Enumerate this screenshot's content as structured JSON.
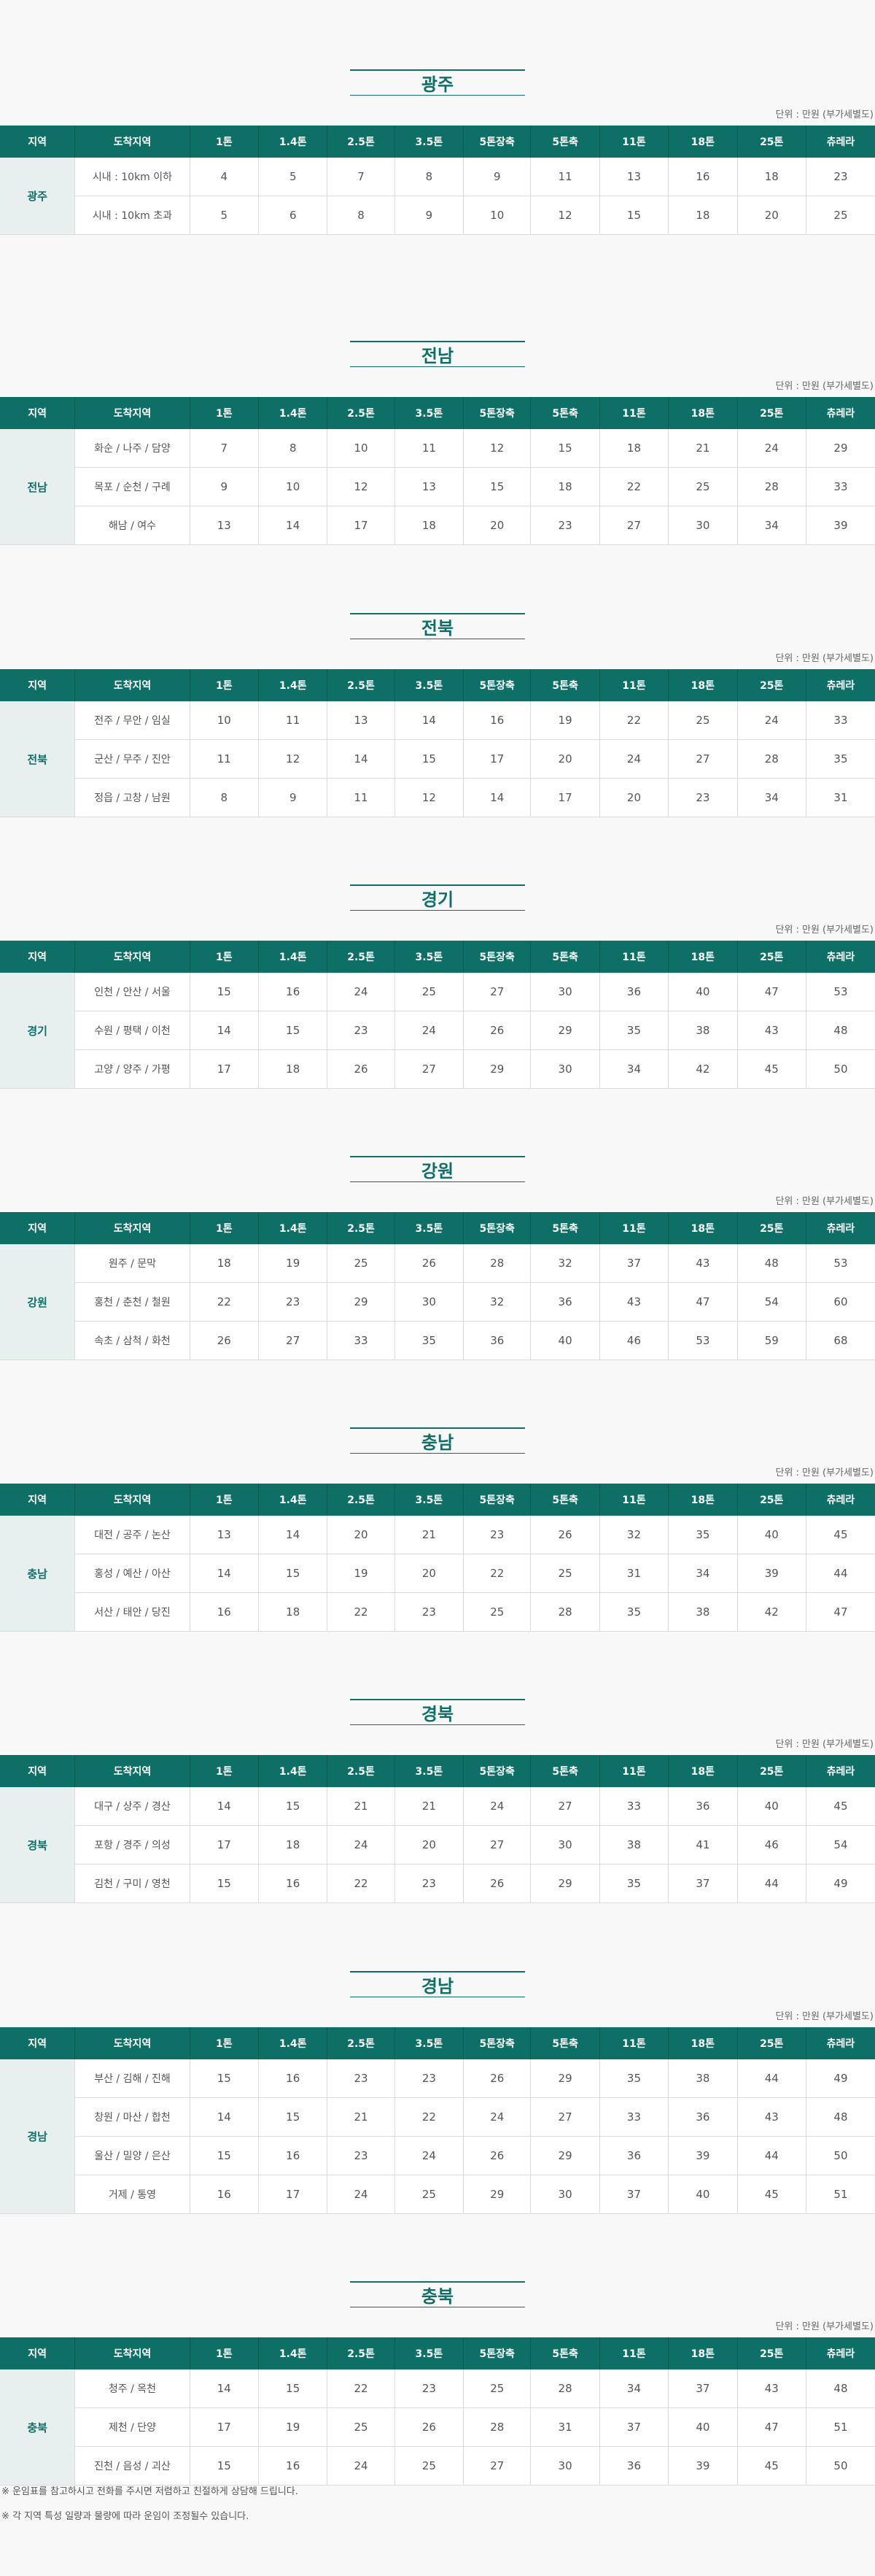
{
  "unit_label": "단위 : 만원 (부가세별도)",
  "headers": [
    "지역",
    "도착지역",
    "1톤",
    "1.4톤",
    "2.5톤",
    "3.5톤",
    "5톤장축",
    "5톤축",
    "11톤",
    "18톤",
    "25톤",
    "츄레라"
  ],
  "sections": [
    {
      "title": "광주",
      "region": "광주",
      "rows": [
        {
          "dest": "시내 : 10km 이하",
          "values": [
            "4",
            "5",
            "7",
            "8",
            "9",
            "11",
            "13",
            "16",
            "18",
            "23"
          ]
        },
        {
          "dest": "시내 : 10km 초과",
          "values": [
            "5",
            "6",
            "8",
            "9",
            "10",
            "12",
            "15",
            "18",
            "20",
            "25"
          ]
        }
      ]
    },
    {
      "title": "전남",
      "region": "전남",
      "rows": [
        {
          "dest": "화순 / 나주 / 담양",
          "values": [
            "7",
            "8",
            "10",
            "11",
            "12",
            "15",
            "18",
            "21",
            "24",
            "29"
          ]
        },
        {
          "dest": "목포 / 순천 / 구례",
          "values": [
            "9",
            "10",
            "12",
            "13",
            "15",
            "18",
            "22",
            "25",
            "28",
            "33"
          ]
        },
        {
          "dest": "해남 / 여수",
          "values": [
            "13",
            "14",
            "17",
            "18",
            "20",
            "23",
            "27",
            "30",
            "34",
            "39"
          ]
        }
      ]
    },
    {
      "title": "전북",
      "region": "전북",
      "rows": [
        {
          "dest": "전주 / 무안 / 임실",
          "values": [
            "10",
            "11",
            "13",
            "14",
            "16",
            "19",
            "22",
            "25",
            "24",
            "33"
          ]
        },
        {
          "dest": "군산 / 무주 / 진안",
          "values": [
            "11",
            "12",
            "14",
            "15",
            "17",
            "20",
            "24",
            "27",
            "28",
            "35"
          ]
        },
        {
          "dest": "정읍 / 고창 / 남원",
          "values": [
            "8",
            "9",
            "11",
            "12",
            "14",
            "17",
            "20",
            "23",
            "34",
            "31"
          ]
        }
      ]
    },
    {
      "title": "경기",
      "region": "경기",
      "rows": [
        {
          "dest": "인천 / 안산 / 서울",
          "values": [
            "15",
            "16",
            "24",
            "25",
            "27",
            "30",
            "36",
            "40",
            "47",
            "53"
          ]
        },
        {
          "dest": "수원 / 평택 / 이천",
          "values": [
            "14",
            "15",
            "23",
            "24",
            "26",
            "29",
            "35",
            "38",
            "43",
            "48"
          ]
        },
        {
          "dest": "고양 / 양주 / 가평",
          "values": [
            "17",
            "18",
            "26",
            "27",
            "29",
            "30",
            "34",
            "42",
            "45",
            "50"
          ]
        }
      ]
    },
    {
      "title": "강원",
      "region": "강원",
      "rows": [
        {
          "dest": "원주 / 문막",
          "values": [
            "18",
            "19",
            "25",
            "26",
            "28",
            "32",
            "37",
            "43",
            "48",
            "53"
          ]
        },
        {
          "dest": "홍천 / 춘천 / 철원",
          "values": [
            "22",
            "23",
            "29",
            "30",
            "32",
            "36",
            "43",
            "47",
            "54",
            "60"
          ]
        },
        {
          "dest": "속초 / 삼척 / 화천",
          "values": [
            "26",
            "27",
            "33",
            "35",
            "36",
            "40",
            "46",
            "53",
            "59",
            "68"
          ]
        }
      ]
    },
    {
      "title": "충남",
      "region": "충남",
      "rows": [
        {
          "dest": "대전 / 공주 / 논산",
          "values": [
            "13",
            "14",
            "20",
            "21",
            "23",
            "26",
            "32",
            "35",
            "40",
            "45"
          ]
        },
        {
          "dest": "홍성 / 예산 / 아산",
          "values": [
            "14",
            "15",
            "19",
            "20",
            "22",
            "25",
            "31",
            "34",
            "39",
            "44"
          ]
        },
        {
          "dest": "서산 / 태안 / 당진",
          "values": [
            "16",
            "18",
            "22",
            "23",
            "25",
            "28",
            "35",
            "38",
            "42",
            "47"
          ]
        }
      ]
    },
    {
      "title": "경북",
      "region": "경북",
      "rows": [
        {
          "dest": "대구 / 상주 / 경산",
          "values": [
            "14",
            "15",
            "21",
            "21",
            "24",
            "27",
            "33",
            "36",
            "40",
            "45"
          ]
        },
        {
          "dest": "포항 / 경주 / 의성",
          "values": [
            "17",
            "18",
            "24",
            "20",
            "27",
            "30",
            "38",
            "41",
            "46",
            "54"
          ]
        },
        {
          "dest": "김천 / 구미 / 영천",
          "values": [
            "15",
            "16",
            "22",
            "23",
            "26",
            "29",
            "35",
            "37",
            "44",
            "49"
          ]
        }
      ]
    },
    {
      "title": "경남",
      "region": "경남",
      "rows": [
        {
          "dest": "부산 / 김해 / 진해",
          "values": [
            "15",
            "16",
            "23",
            "23",
            "26",
            "29",
            "35",
            "38",
            "44",
            "49"
          ]
        },
        {
          "dest": "창원 / 마산 / 합천",
          "values": [
            "14",
            "15",
            "21",
            "22",
            "24",
            "27",
            "33",
            "36",
            "43",
            "48"
          ]
        },
        {
          "dest": "울산 / 밀양 / 은산",
          "values": [
            "15",
            "16",
            "23",
            "24",
            "26",
            "29",
            "36",
            "39",
            "44",
            "50"
          ]
        },
        {
          "dest": "거제 / 통영",
          "values": [
            "16",
            "17",
            "24",
            "25",
            "29",
            "30",
            "37",
            "40",
            "45",
            "51"
          ]
        }
      ]
    },
    {
      "title": "충북",
      "region": "충북",
      "rows": [
        {
          "dest": "청주 / 옥천",
          "values": [
            "14",
            "15",
            "22",
            "23",
            "25",
            "28",
            "34",
            "37",
            "43",
            "48"
          ]
        },
        {
          "dest": "제천 / 단양",
          "values": [
            "17",
            "19",
            "25",
            "26",
            "28",
            "31",
            "37",
            "40",
            "47",
            "51"
          ]
        },
        {
          "dest": "진천 / 음성 / 괴산",
          "values": [
            "15",
            "16",
            "24",
            "25",
            "27",
            "30",
            "36",
            "39",
            "45",
            "50"
          ]
        }
      ]
    }
  ],
  "notes": [
    "※ 운임표를 참고하시고 전화를 주시면 저렴하고 친절하게 상담해 드립니다.",
    "※ 각 지역 특성 일량과 물량에 따라 운임이 조정될수 있습니다."
  ]
}
